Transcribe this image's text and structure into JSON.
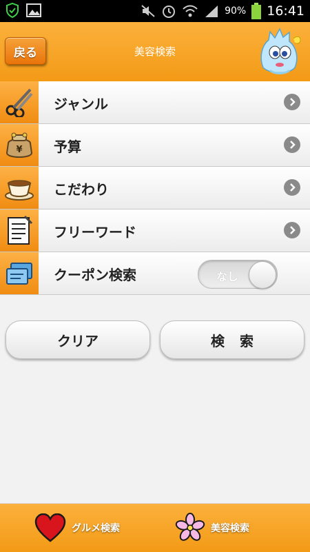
{
  "status_bar": {
    "battery_percent": "90%",
    "time": "16:41"
  },
  "header": {
    "back_label": "戻る",
    "title": "美容検索"
  },
  "menu": {
    "items": [
      {
        "label": "ジャンル",
        "icon": "scissors-icon"
      },
      {
        "label": "予算",
        "icon": "coin-purse-icon"
      },
      {
        "label": "こだわり",
        "icon": "coffee-cup-icon"
      },
      {
        "label": "フリーワード",
        "icon": "notepad-icon"
      }
    ],
    "coupon": {
      "label": "クーポン検索",
      "icon": "coupon-card-icon",
      "toggle_label": "なし",
      "toggle_on": false
    }
  },
  "actions": {
    "clear_label": "クリア",
    "search_label": "検索"
  },
  "tabs": {
    "gourmet_label": "グルメ検索",
    "beauty_label": "美容検索"
  },
  "colors": {
    "accent": "#f5a322",
    "header_text": "#ffffff"
  }
}
